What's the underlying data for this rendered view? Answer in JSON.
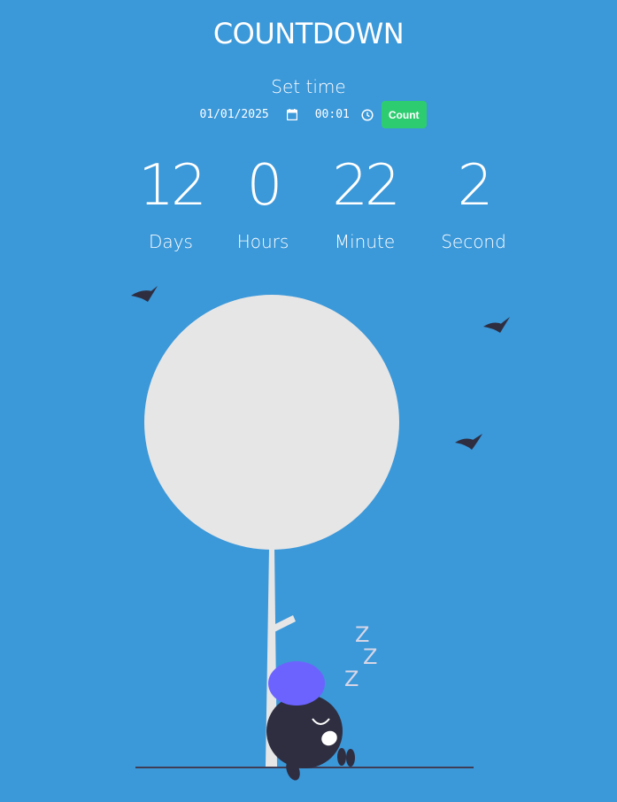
{
  "header": {
    "title": "COUNTDOWN"
  },
  "setter": {
    "label": "Set time",
    "date_value": "01/01/2025",
    "time_value": "00:01",
    "count_label": "Count"
  },
  "timer": {
    "units": [
      {
        "value": "12",
        "label": "Days"
      },
      {
        "value": "0",
        "label": "Hours"
      },
      {
        "value": "22",
        "label": "Minute"
      },
      {
        "value": "2",
        "label": "Second"
      }
    ]
  },
  "illustration": {
    "snore_letters": [
      "Z",
      "Z",
      "Z"
    ],
    "icons": [
      "bird-icon",
      "tree-icon",
      "sleeping-character-icon",
      "calendar-icon",
      "clock-icon"
    ]
  },
  "colors": {
    "background": "#3b98d9",
    "button": "#2ecc71",
    "tree": "#e6e6e6",
    "hat": "#6c63ff",
    "body": "#2f2e41"
  }
}
